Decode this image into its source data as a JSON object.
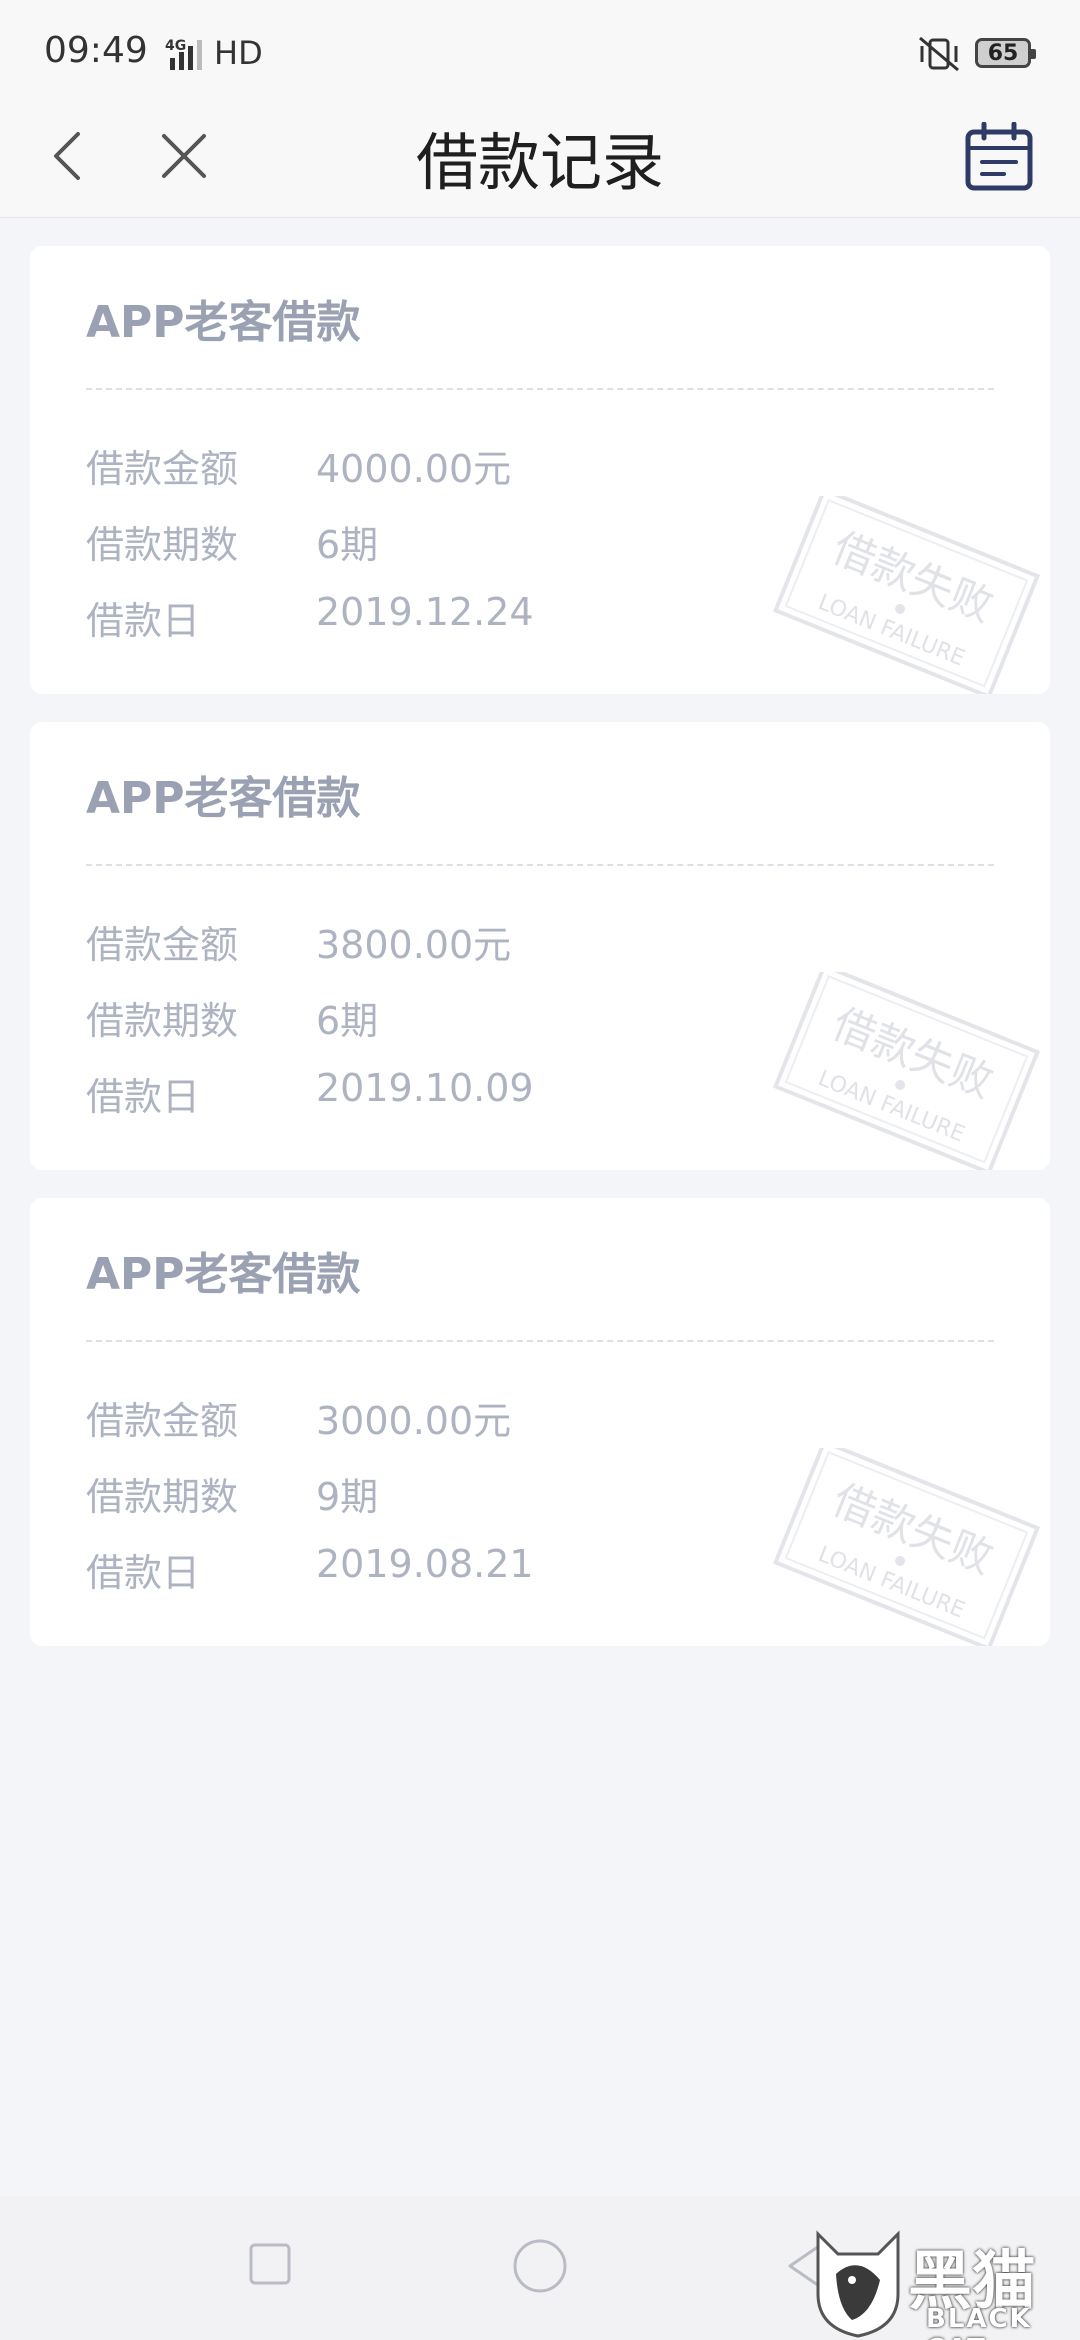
{
  "status_bar": {
    "time": "09:49",
    "network": "4G",
    "hd": "HD",
    "battery": "65"
  },
  "header": {
    "title": "借款记录"
  },
  "records": [
    {
      "title": "APP老客借款",
      "amount_label": "借款金额",
      "amount": "4000.00元",
      "periods_label": "借款期数",
      "periods": "6期",
      "date_label": "借款日",
      "date": "2019.12.24",
      "stamp_cn": "借款失败",
      "stamp_en": "LOAN FAILURE"
    },
    {
      "title": "APP老客借款",
      "amount_label": "借款金额",
      "amount": "3800.00元",
      "periods_label": "借款期数",
      "periods": "6期",
      "date_label": "借款日",
      "date": "2019.10.09",
      "stamp_cn": "借款失败",
      "stamp_en": "LOAN FAILURE"
    },
    {
      "title": "APP老客借款",
      "amount_label": "借款金额",
      "amount": "3000.00元",
      "periods_label": "借款期数",
      "periods": "9期",
      "date_label": "借款日",
      "date": "2019.08.21",
      "stamp_cn": "借款失败",
      "stamp_en": "LOAN FAILURE"
    }
  ],
  "watermark": {
    "cn": "黑猫",
    "en": "BLACK CAT"
  },
  "colors": {
    "background": "#f4f5f8",
    "card": "#ffffff",
    "muted_text": "#aeb3c2",
    "title_text": "#9aa1b3",
    "accent": "#2f3b66"
  }
}
